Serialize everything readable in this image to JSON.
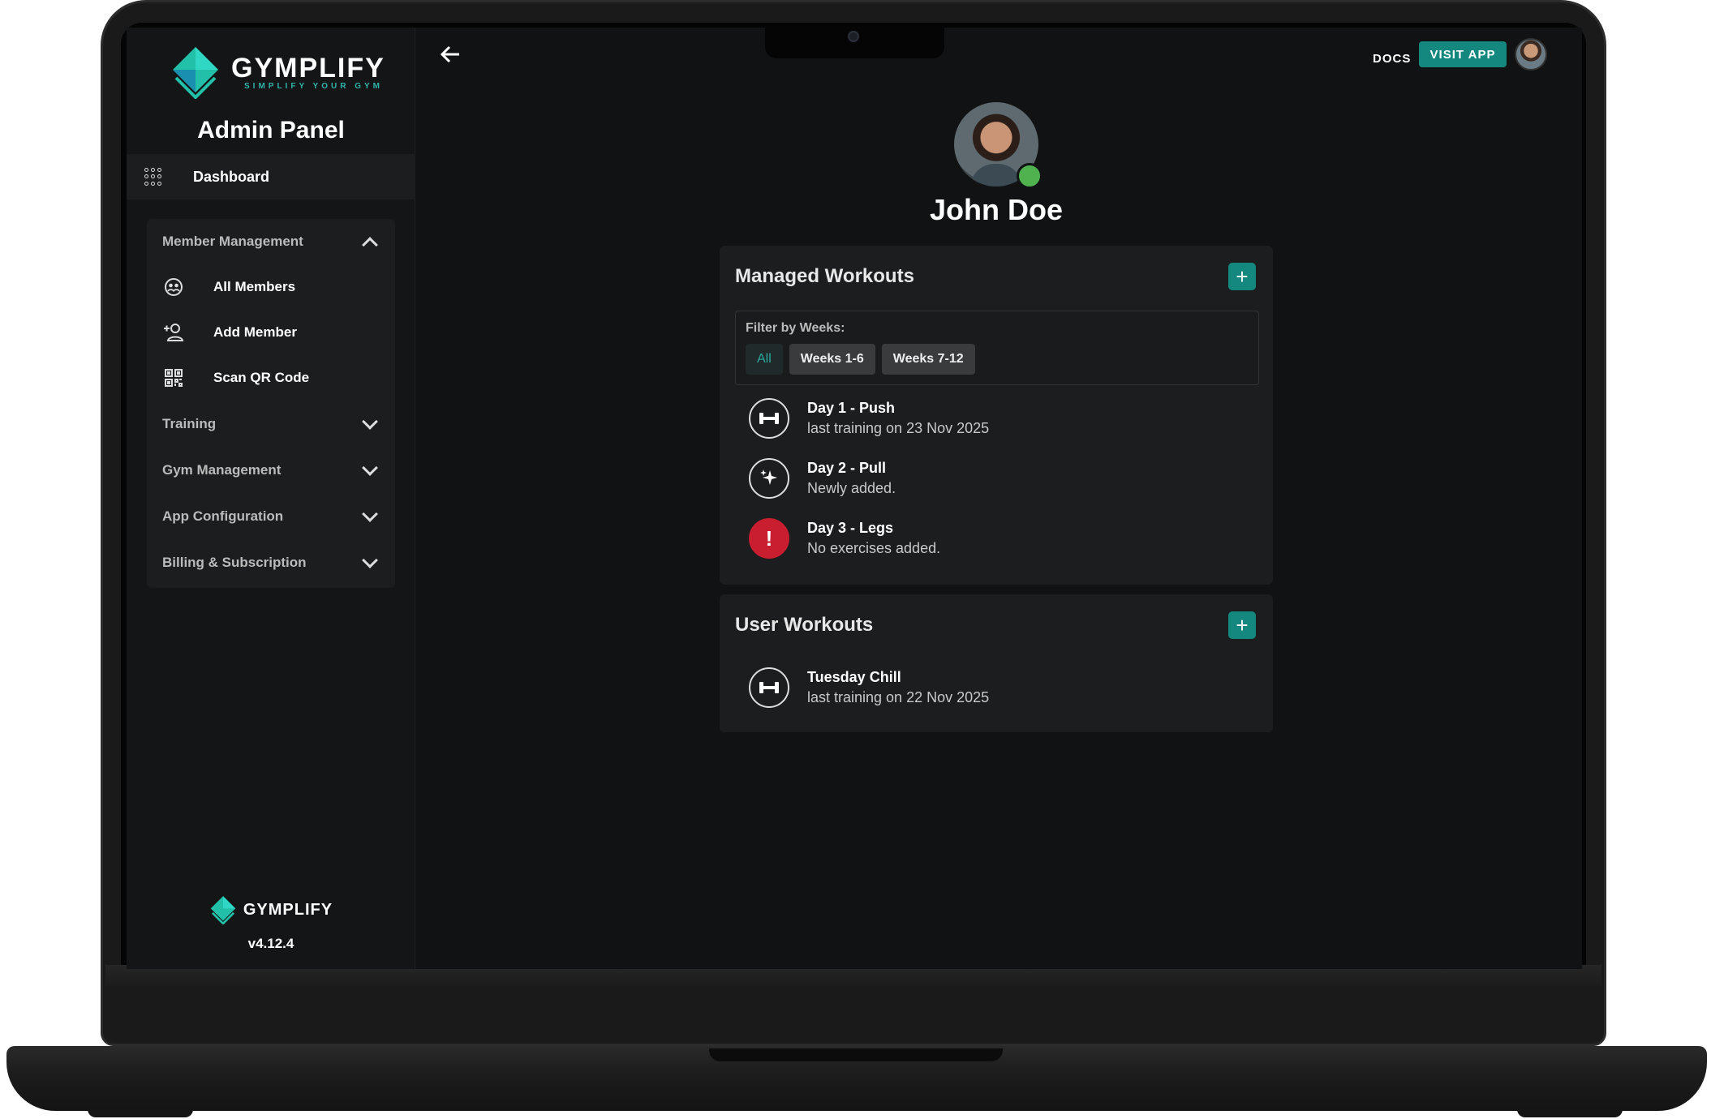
{
  "brand": {
    "name": "GYMPLIFY",
    "tagline": "SIMPLIFY YOUR GYM",
    "version": "v4.12.4"
  },
  "sidebar": {
    "title": "Admin Panel",
    "dashboard": "Dashboard",
    "sections": [
      {
        "label": "Member Management",
        "expanded": true,
        "items": [
          {
            "label": "All Members",
            "icon": "members-icon"
          },
          {
            "label": "Add Member",
            "icon": "add-user-icon"
          },
          {
            "label": "Scan QR Code",
            "icon": "qr-code-icon"
          }
        ]
      },
      {
        "label": "Training",
        "expanded": false
      },
      {
        "label": "Gym Management",
        "expanded": false
      },
      {
        "label": "App Configuration",
        "expanded": false
      },
      {
        "label": "Billing & Subscription",
        "expanded": false
      }
    ]
  },
  "topbar": {
    "docs": "DOCS",
    "visit_app": "VISIT APP"
  },
  "profile": {
    "name": "John Doe",
    "status": "online"
  },
  "managed": {
    "title": "Managed Workouts",
    "add": "+",
    "filter_label": "Filter by Weeks:",
    "filters": [
      "All",
      "Weeks 1-6",
      "Weeks 7-12"
    ],
    "active_filter": "All",
    "workouts": [
      {
        "title": "Day 1 - Push",
        "subtitle": "last training on 23 Nov 2025",
        "icon": "dumbbell-icon"
      },
      {
        "title": "Day 2 - Pull",
        "subtitle": "Newly added.",
        "icon": "sparkle-icon"
      },
      {
        "title": "Day 3 - Legs",
        "subtitle": "No exercises added.",
        "icon": "warning-icon",
        "badge": "!"
      }
    ]
  },
  "user": {
    "title": "User Workouts",
    "add": "+",
    "workouts": [
      {
        "title": "Tuesday Chill",
        "subtitle": "last training on 22 Nov 2025",
        "icon": "dumbbell-icon"
      }
    ]
  },
  "colors": {
    "accent": "#14877e",
    "online": "#4fb24f",
    "error": "#c81e2f",
    "background": "#111213",
    "card": "#1c1d1f"
  }
}
